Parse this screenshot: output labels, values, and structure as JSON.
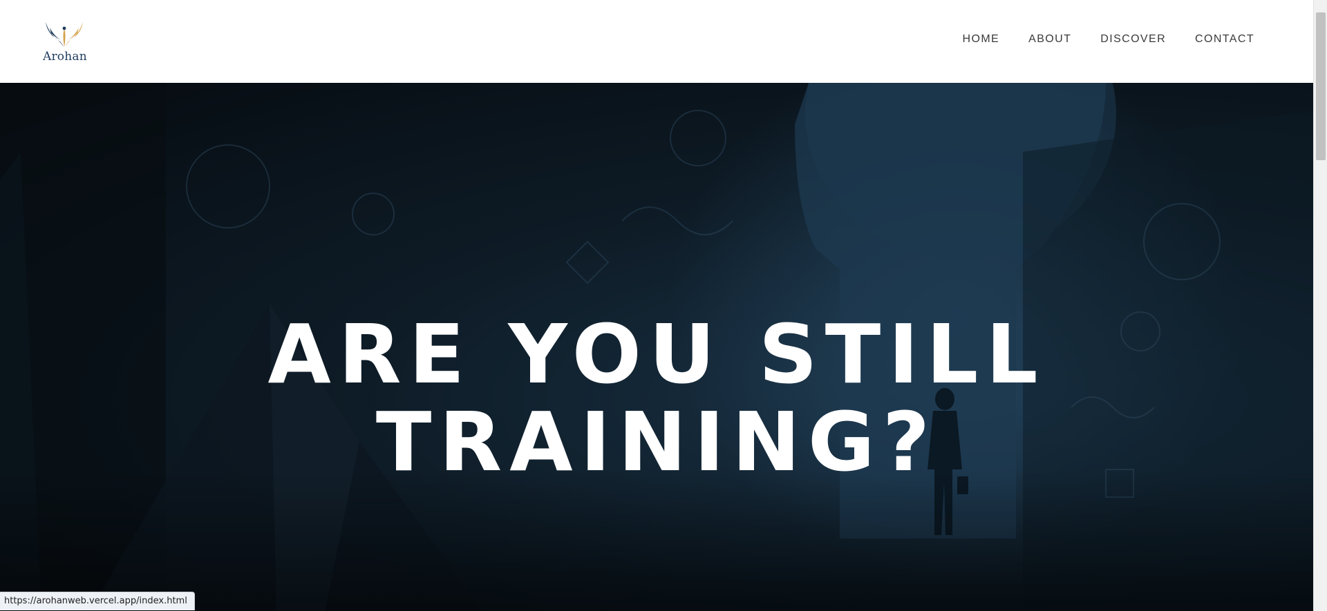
{
  "brand": {
    "name": "Arohan",
    "primary_color": "#1f3b5c",
    "accent_color": "#d4a24a"
  },
  "nav": {
    "items": [
      {
        "label": "HOME"
      },
      {
        "label": "ABOUT"
      },
      {
        "label": "DISCOVER"
      },
      {
        "label": "CONTACT"
      }
    ]
  },
  "hero": {
    "line1": "ARE YOU STILL",
    "line2": "TRAINING?",
    "text_color": "#ffffff"
  },
  "status_bar": {
    "url": "https://arohanweb.vercel.app/index.html"
  }
}
